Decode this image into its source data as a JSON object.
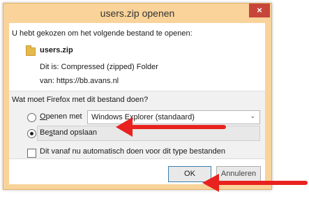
{
  "window": {
    "title": "users.zip openen",
    "close_label": "×"
  },
  "intro_text": "U hebt gekozen om het volgende bestand te openen:",
  "file": {
    "name": "users.zip",
    "type_text": "Dit is: Compressed (zipped) Folder",
    "source_text": "van: https://bb.avans.nl"
  },
  "question": "Wat moet Firefox met dit bestand doen?",
  "options": {
    "open_with": {
      "mnemonic": "O",
      "label_rest": "penen met",
      "selected": false
    },
    "app_select": {
      "value": "Windows Explorer (standaard)",
      "chevron": "⌄"
    },
    "save_file": {
      "label_pre": "Be",
      "mnemonic": "s",
      "label_post": "tand opslaan",
      "selected": true
    },
    "auto_checkbox": {
      "label": "Dit vanaf nu automatisch doen voor dit type bestanden",
      "checked": false
    }
  },
  "buttons": {
    "ok": "OK",
    "cancel": "Annuleren"
  },
  "colors": {
    "titlebar": "#f9d39a",
    "close": "#c7463a",
    "arrow": "#e8221e",
    "ok_border": "#3c7fb1"
  },
  "annotations": [
    {
      "points_to": "save-file-option"
    },
    {
      "points_to": "ok-button"
    }
  ]
}
